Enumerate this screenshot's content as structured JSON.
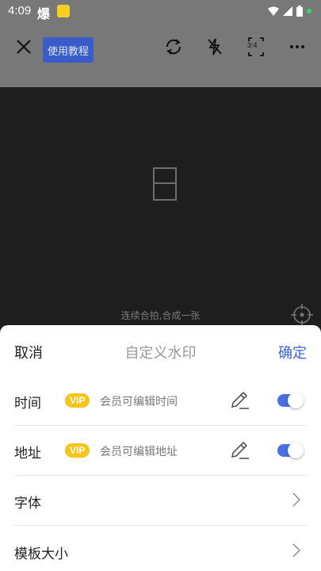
{
  "status_bar": {
    "time": "4:09",
    "app_icon_text": "爆"
  },
  "toolbar": {
    "tutorial_label": "使用教程",
    "icons": [
      "close-icon",
      "rotate-camera-icon",
      "flash-off-icon",
      "ratio-icon",
      "more-icon"
    ],
    "ratio_label": "3:4"
  },
  "camera": {
    "hint": "连续合拍,合成一张"
  },
  "sheet": {
    "cancel_label": "取消",
    "title": "自定义水印",
    "confirm_label": "确定",
    "rows": [
      {
        "label": "时间",
        "vip": "VIP",
        "hint": "会员可编辑时间",
        "enabled": true
      },
      {
        "label": "地址",
        "vip": "VIP",
        "hint": "会员可编辑地址",
        "enabled": true
      },
      {
        "label": "字体"
      },
      {
        "label": "模板大小"
      }
    ]
  },
  "colors": {
    "accent": "#3a63d6",
    "vip": "#f5c518",
    "toggle_on": "#4a6fe0",
    "toolbar_bg": "#787878",
    "camera_bg": "#1e1e1e"
  }
}
